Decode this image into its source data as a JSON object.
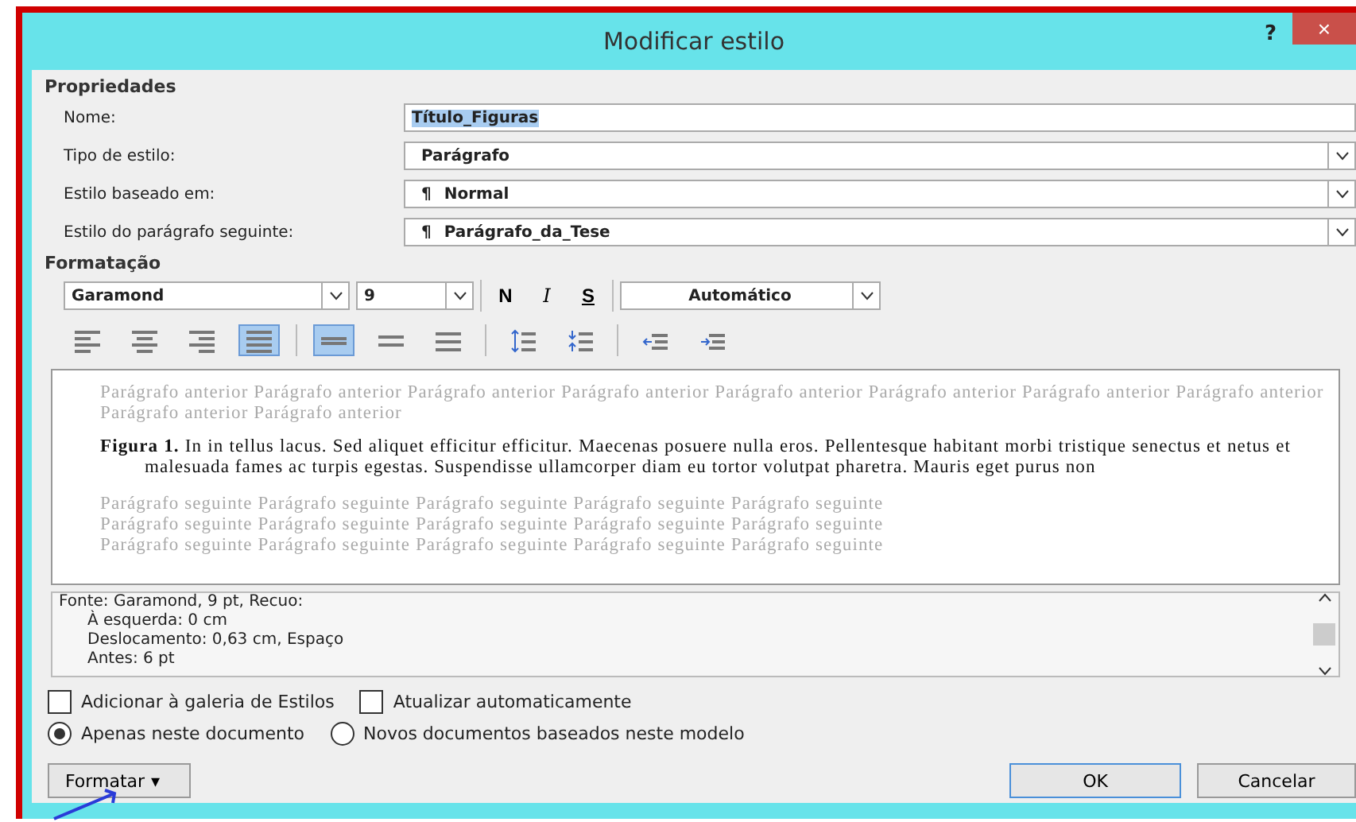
{
  "window": {
    "title": "Modificar estilo",
    "help": "?",
    "close": "×"
  },
  "properties": {
    "heading": "Propriedades",
    "fields": [
      {
        "label": "Nome:",
        "kind": "text",
        "value": "Título_Figuras",
        "selected": true
      },
      {
        "label": "Tipo de estilo:",
        "kind": "dropdown",
        "value": "Parágrafo"
      },
      {
        "label": "Estilo baseado em:",
        "kind": "dropdown",
        "value": "Normal",
        "mark": "¶"
      },
      {
        "label": "Estilo do parágrafo seguinte:",
        "kind": "dropdown",
        "value": "Parágrafo_da_Tese",
        "mark": "¶"
      }
    ]
  },
  "formatting": {
    "heading": "Formatação",
    "font": "Garamond",
    "size": "9",
    "bold": "N",
    "italic": "I",
    "underline": "S",
    "color_label": "Automático",
    "tools": [
      {
        "kind": "align-left",
        "selected": false
      },
      {
        "kind": "align-center",
        "selected": false
      },
      {
        "kind": "align-right",
        "selected": false
      },
      {
        "kind": "justify",
        "selected": true
      },
      {
        "kind": "sep"
      },
      {
        "kind": "single",
        "selected": true
      },
      {
        "kind": "one-half",
        "selected": false
      },
      {
        "kind": "double",
        "selected": false
      },
      {
        "kind": "sep"
      },
      {
        "kind": "space-up",
        "selected": false
      },
      {
        "kind": "space-down",
        "selected": false
      },
      {
        "kind": "sep"
      },
      {
        "kind": "outdent",
        "selected": false
      },
      {
        "kind": "indent",
        "selected": false
      }
    ]
  },
  "preview": {
    "previous": "Parágrafo anterior Parágrafo anterior Parágrafo anterior Parágrafo anterior Parágrafo anterior Parágrafo anterior Parágrafo anterior Parágrafo anterior Parágrafo anterior Parágrafo anterior",
    "sample": "**Figura 1.** In in tellus lacus. Sed aliquet efficitur efficitur. Maecenas posuere nulla eros. Pellentesque habitant morbi tristique senectus et netus et malesuada fames ac turpis egestas. Suspendisse ullamcorper diam eu tortor volutpat pharetra. Mauris eget purus non",
    "following": [
      "Parágrafo seguinte Parágrafo seguinte Parágrafo seguinte Parágrafo seguinte Parágrafo seguinte",
      "Parágrafo seguinte Parágrafo seguinte Parágrafo seguinte Parágrafo seguinte Parágrafo seguinte",
      "Parágrafo seguinte Parágrafo seguinte Parágrafo seguinte Parágrafo seguinte Parágrafo seguinte"
    ]
  },
  "description": [
    "Fonte: Garamond, 9 pt, Recuo:",
    "À esquerda:  0 cm",
    "Deslocamento:  0,63 cm, Espaço",
    "Antes:  6 pt"
  ],
  "options": [
    {
      "label": "Adicionar à galeria de Estilos",
      "checked": false
    },
    {
      "label": "Atualizar automaticamente",
      "checked": false
    }
  ],
  "scope": [
    {
      "label": "Apenas neste documento",
      "selected": true
    },
    {
      "label": "Novos documentos baseados neste modelo",
      "selected": false
    }
  ],
  "buttons": {
    "format": "Formatar",
    "format_caret": "▾",
    "ok": "OK",
    "cancel": "Cancelar"
  }
}
